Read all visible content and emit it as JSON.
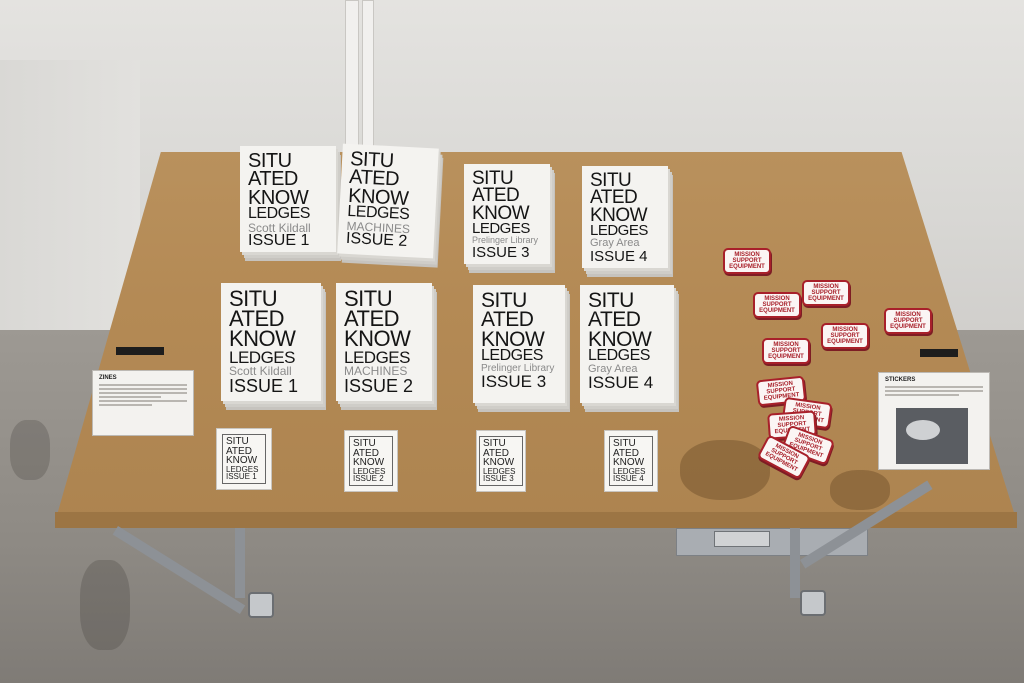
{
  "zines_top": [
    {
      "l1": "SITU",
      "l2": "ATED",
      "l3": "KNOW",
      "l4": "LEDGES",
      "who": "Scott Kildall",
      "issue": "ISSUE 1"
    },
    {
      "l1": "SITU",
      "l2": "ATED",
      "l3": "KNOW",
      "l4": "LEDGES",
      "who": "MACHINES",
      "issue": "ISSUE 2"
    },
    {
      "l1": "SITU",
      "l2": "ATED",
      "l3": "KNOW",
      "l4": "LEDGES",
      "who": "Prelinger Library",
      "issue": "ISSUE 3"
    },
    {
      "l1": "SITU",
      "l2": "ATED",
      "l3": "KNOW",
      "l4": "LEDGES",
      "who": "Gray Area",
      "issue": "ISSUE 4"
    }
  ],
  "zines_mid": [
    {
      "l1": "SITU",
      "l2": "ATED",
      "l3": "KNOW",
      "l4": "LEDGES",
      "who": "Scott Kildall",
      "issue": "ISSUE 1"
    },
    {
      "l1": "SITU",
      "l2": "ATED",
      "l3": "KNOW",
      "l4": "LEDGES",
      "who": "MACHINES",
      "issue": "ISSUE 2"
    },
    {
      "l1": "SITU",
      "l2": "ATED",
      "l3": "KNOW",
      "l4": "LEDGES",
      "who": "Prelinger Library",
      "issue": "ISSUE 3"
    },
    {
      "l1": "SITU",
      "l2": "ATED",
      "l3": "KNOW",
      "l4": "LEDGES",
      "who": "Gray Area",
      "issue": "ISSUE 4"
    }
  ],
  "cards": [
    {
      "l1": "SITU",
      "l2": "ATED",
      "l3": "KNOW",
      "l4": "LEDGES",
      "issue": "ISSUE 1"
    },
    {
      "l1": "SITU",
      "l2": "ATED",
      "l3": "KNOW",
      "l4": "LEDGES",
      "issue": "ISSUE 2"
    },
    {
      "l1": "SITU",
      "l2": "ATED",
      "l3": "KNOW",
      "l4": "LEDGES",
      "issue": "ISSUE 3"
    },
    {
      "l1": "SITU",
      "l2": "ATED",
      "l3": "KNOW",
      "l4": "LEDGES",
      "issue": "ISSUE 4"
    }
  ],
  "signs": {
    "left_title": "ZINES",
    "right_title": "STICKERS"
  },
  "sticker_text": {
    "l1": "MISSION",
    "l2": "SUPPORT",
    "l3": "EQUIPMENT"
  },
  "colors": {
    "sticker_red": "#a8202a",
    "wood": "#b48a55",
    "paper": "#f4f3f0"
  }
}
